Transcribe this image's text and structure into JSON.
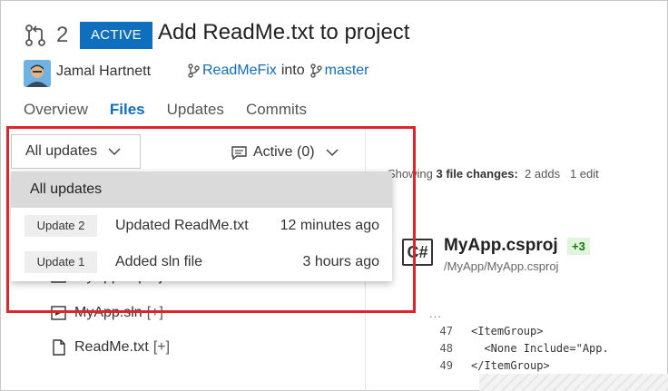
{
  "header": {
    "pr_number": "2",
    "status": "ACTIVE",
    "title": "Add ReadMe.txt to project",
    "author": "Jamal Hartnett",
    "source_branch": "ReadMeFix",
    "into": "into",
    "target_branch": "master"
  },
  "tabs": [
    {
      "label": "Overview"
    },
    {
      "label": "Files"
    },
    {
      "label": "Updates"
    },
    {
      "label": "Commits"
    }
  ],
  "filter": {
    "label": "All updates",
    "comments_label": "Active (0)"
  },
  "dropdown": {
    "all_label": "All updates",
    "items": [
      {
        "tag": "Update 2",
        "description": "Updated ReadMe.txt",
        "time": "12 minutes ago"
      },
      {
        "tag": "Update 1",
        "description": "Added sln file",
        "time": "3 hours ago"
      }
    ]
  },
  "tree": [
    {
      "name": "MyApp.csproj",
      "mod": ""
    },
    {
      "name": "MyApp.sln",
      "mod": "[+]"
    },
    {
      "name": "ReadMe.txt",
      "mod": "[+]"
    }
  ],
  "summary": {
    "prefix": "Showing",
    "count": "3 file changes:",
    "adds": "2 adds",
    "edits": "1 edit"
  },
  "file": {
    "icon_text": "C#",
    "name": "MyApp.csproj",
    "badge": "+3",
    "path": "/MyApp/MyApp.csproj"
  },
  "code": {
    "ellipsis": "...",
    "lines": [
      {
        "num": "47",
        "text": "<ItemGroup>"
      },
      {
        "num": "48",
        "text": "  <None Include=\"App."
      },
      {
        "num": "49",
        "text": "</ItemGroup>"
      }
    ]
  },
  "colors": {
    "accent": "#106ebe",
    "highlight": "#e0242b",
    "add_green": "#107c10"
  }
}
